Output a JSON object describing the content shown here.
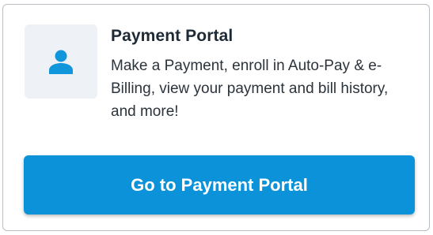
{
  "card": {
    "icon": "user-icon",
    "title": "Payment Portal",
    "description": "Make a Payment, enroll in Auto-Pay & e-Billing, view your payment and bill history, and more!",
    "button_label": "Go to Payment Portal"
  },
  "colors": {
    "accent": "#0b92d9",
    "icon": "#1296db",
    "icon_tile_bg": "#eef1f5",
    "title_text": "#1e2a36",
    "border": "#b9bec5"
  }
}
